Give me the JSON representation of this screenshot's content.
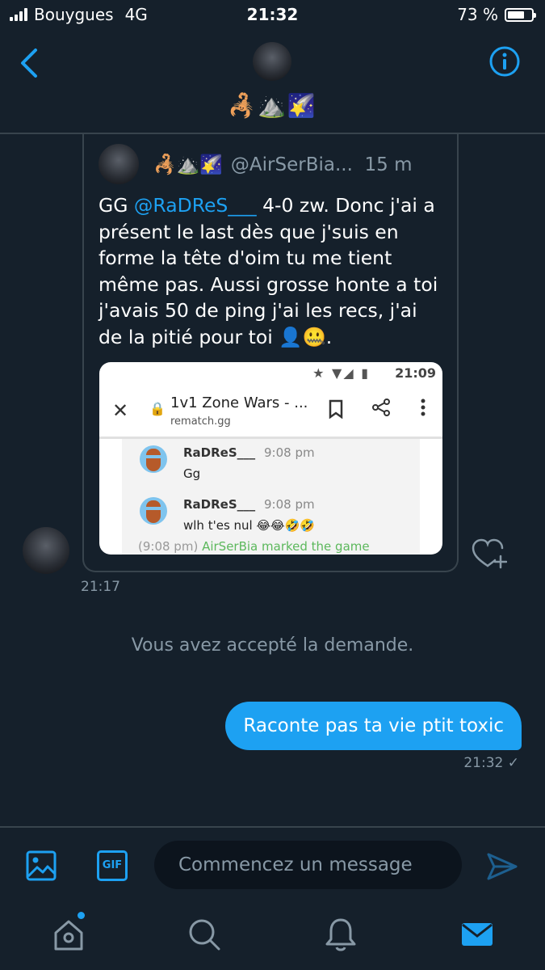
{
  "status_bar": {
    "carrier": "Bouygues",
    "network": "4G",
    "time": "21:32",
    "battery_text": "73 %",
    "battery_level": 0.73
  },
  "header": {
    "name": "🦂⛰️🌠",
    "back_icon": "chevron-left-icon",
    "info_icon": "info-icon"
  },
  "quoted_tweet": {
    "name_emoji": "🦂⛰️🌠",
    "handle": "@AirSerBia...",
    "age": "15 m",
    "text_before": "GG ",
    "mention": "@RaDReS___",
    "text_after": " 4-0 zw. Donc j'ai a présent le last dès que j'suis en forme la tête d'oim tu me tient même pas. Aussi grosse honte a toi j'avais 50 de ping j'ai les recs, j'ai de la pitié pour toi 👤🤐.",
    "screenshot": {
      "status_time": "21:09",
      "page_title": "1v1 Zone Wars - ...",
      "page_url": "rematch.gg",
      "messages": [
        {
          "user": "RaDReS___",
          "time": "9:08 pm",
          "body": "Gg"
        },
        {
          "user": "RaDReS___",
          "time": "9:08 pm",
          "body": "wlh t'es nul 😂😂🤣🤣"
        }
      ],
      "system_time": "(9:08 pm)",
      "system_user": "AirSerBia",
      "system_action": "marked the game"
    }
  },
  "thread": {
    "time_1": "21:17",
    "system_note": "Vous avez accepté la demande.",
    "sent_message": "Raconte pas ta vie ptit toxic",
    "time_2": "21:32 ✓"
  },
  "composer": {
    "gif_label": "GIF",
    "placeholder": "Commencez un message"
  },
  "tabbar": {
    "items": [
      "home-icon",
      "search-icon",
      "notifications-icon",
      "messages-icon"
    ],
    "accent": "#1da1f2"
  }
}
